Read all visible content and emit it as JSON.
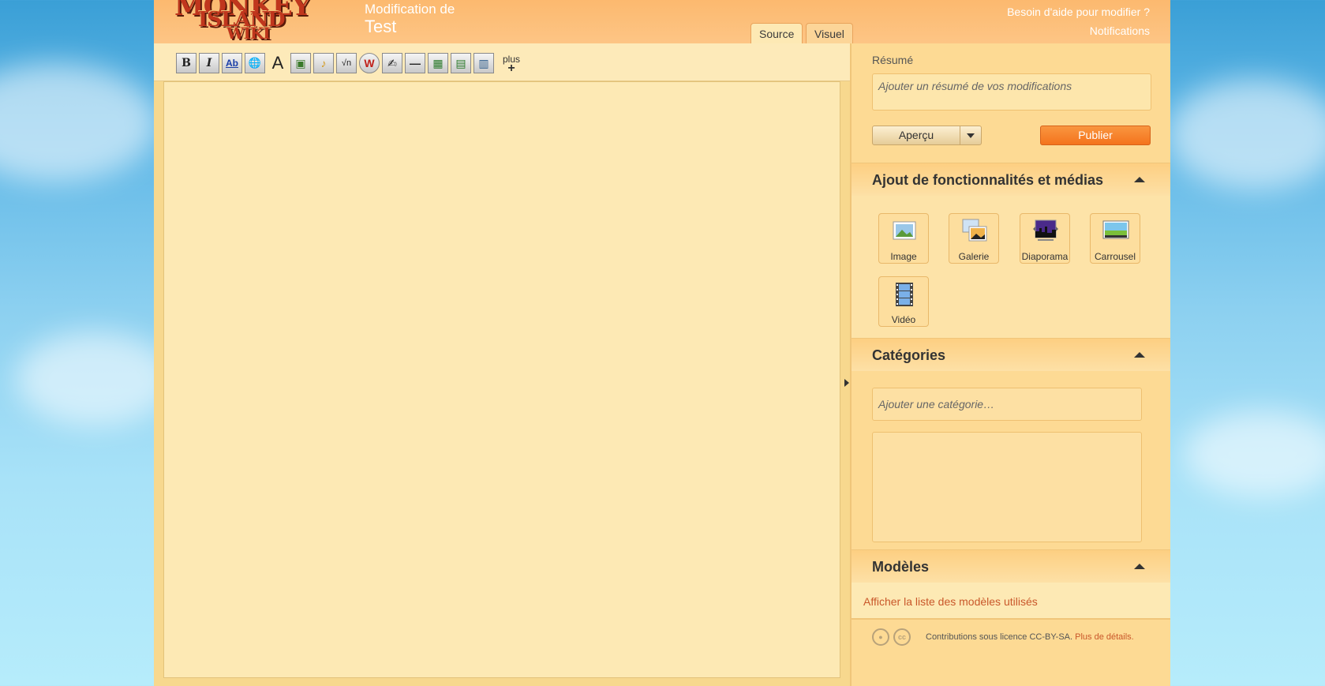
{
  "header": {
    "logo_text": "MONKEY ISLAND WIKI",
    "edit_label": "Modification de",
    "page_title": "Test",
    "tabs": [
      {
        "label": "Source",
        "active": true
      },
      {
        "label": "Visuel",
        "active": false
      }
    ],
    "help_link": "Besoin d'aide pour modifier ?",
    "notifications_link": "Notifications"
  },
  "toolbar": {
    "buttons": [
      {
        "name": "bold-button",
        "glyph": "B"
      },
      {
        "name": "italic-button",
        "glyph": "I"
      },
      {
        "name": "internal-link-button",
        "glyph": "Ab"
      },
      {
        "name": "external-link-button",
        "glyph": "🌐"
      },
      {
        "name": "heading-button",
        "glyph": "A"
      },
      {
        "name": "image-button",
        "glyph": "▣"
      },
      {
        "name": "media-button",
        "glyph": "♪"
      },
      {
        "name": "math-button",
        "glyph": "√n"
      },
      {
        "name": "nowiki-button",
        "glyph": "W"
      },
      {
        "name": "signature-button",
        "glyph": "✍"
      },
      {
        "name": "horizontal-line-button",
        "glyph": "—"
      },
      {
        "name": "insert-image-button",
        "glyph": "▦"
      },
      {
        "name": "insert-gallery-button",
        "glyph": "▤"
      },
      {
        "name": "insert-video-button",
        "glyph": "▥"
      }
    ],
    "more_label": "plus",
    "more_glyph": "+"
  },
  "rail": {
    "summary_label": "Résumé",
    "summary_placeholder": "Ajouter un résumé de vos modifications",
    "preview_label": "Aperçu",
    "publish_label": "Publier",
    "features_title": "Ajout de fonctionnalités et médias",
    "media": [
      {
        "label": "Image"
      },
      {
        "label": "Galerie"
      },
      {
        "label": "Diaporama"
      },
      {
        "label": "Carrousel"
      },
      {
        "label": "Vidéo"
      }
    ],
    "categories_title": "Catégories",
    "category_placeholder": "Ajouter une catégorie…",
    "templates_title": "Modèles",
    "templates_link": "Afficher la liste des modèles utilisés",
    "license_text": "Contributions sous licence CC-BY-SA.",
    "license_link": "Plus de détails."
  },
  "colors": {
    "accent": "#f4731c",
    "header": "#fcb96f",
    "panel": "#fde9b4",
    "link": "#c9572a"
  }
}
